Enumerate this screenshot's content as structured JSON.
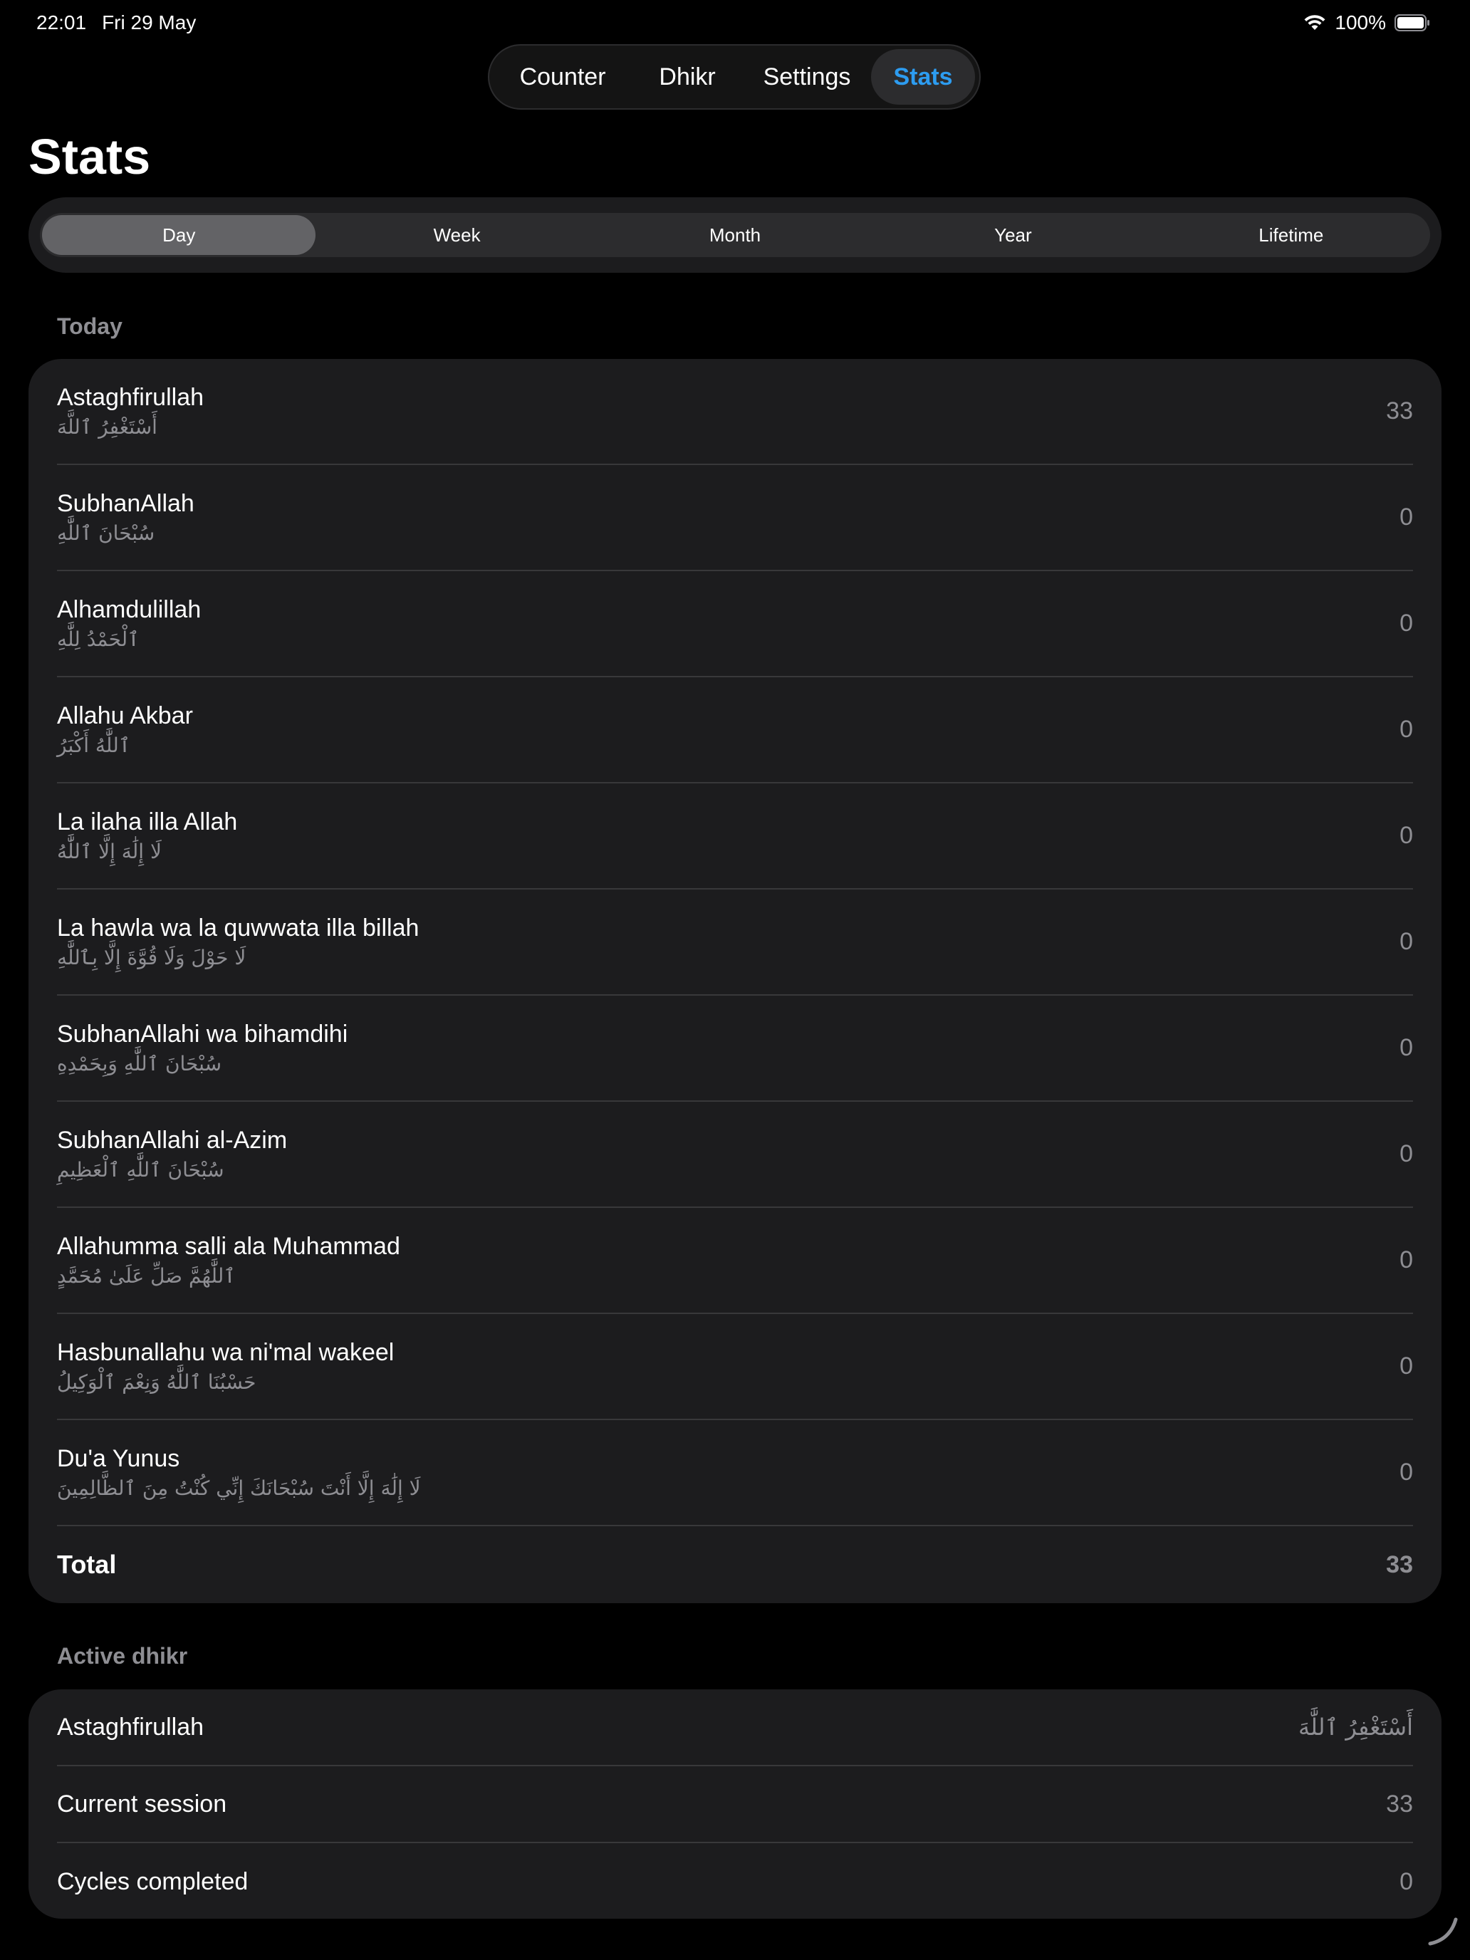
{
  "status_bar": {
    "time": "22:01",
    "date": "Fri 29 May",
    "battery": "100%"
  },
  "top_tabs": [
    {
      "label": "Counter",
      "active": false
    },
    {
      "label": "Dhikr",
      "active": false
    },
    {
      "label": "Settings",
      "active": false
    },
    {
      "label": "Stats",
      "active": true
    }
  ],
  "page_title": "Stats",
  "periods": [
    {
      "label": "Day",
      "active": true
    },
    {
      "label": "Week",
      "active": false
    },
    {
      "label": "Month",
      "active": false
    },
    {
      "label": "Year",
      "active": false
    },
    {
      "label": "Lifetime",
      "active": false
    }
  ],
  "today": {
    "header": "Today",
    "items": [
      {
        "name": "Astaghfirullah",
        "arabic": "أَسْتَغْفِرُ ٱللَّهَ",
        "count": "33"
      },
      {
        "name": "SubhanAllah",
        "arabic": "سُبْحَانَ ٱللَّٰهِ",
        "count": "0"
      },
      {
        "name": "Alhamdulillah",
        "arabic": "ٱلْحَمْدُ لِلَّٰهِ",
        "count": "0"
      },
      {
        "name": "Allahu Akbar",
        "arabic": "ٱللَّٰهُ أَكْبَرُ",
        "count": "0"
      },
      {
        "name": "La ilaha illa Allah",
        "arabic": "لَا إِلَٰهَ إِلَّا ٱللَّٰهُ",
        "count": "0"
      },
      {
        "name": "La hawla wa la quwwata illa billah",
        "arabic": "لَا حَوْلَ وَلَا قُوَّةَ إِلَّا بِٱللَّٰهِ",
        "count": "0"
      },
      {
        "name": "SubhanAllahi wa bihamdihi",
        "arabic": "سُبْحَانَ ٱللَّٰهِ وَبِحَمْدِهِ",
        "count": "0"
      },
      {
        "name": "SubhanAllahi al-Azim",
        "arabic": "سُبْحَانَ ٱللَّٰهِ ٱلْعَظِيمِ",
        "count": "0"
      },
      {
        "name": "Allahumma salli ala Muhammad",
        "arabic": "ٱللَّٰهُمَّ صَلِّ عَلَىٰ مُحَمَّدٍ",
        "count": "0"
      },
      {
        "name": "Hasbunallahu wa ni'mal wakeel",
        "arabic": "حَسْبُنَا ٱللَّٰهُ وَنِعْمَ ٱلْوَكِيلُ",
        "count": "0"
      },
      {
        "name": "Du'a Yunus",
        "arabic": "لَا إِلَٰهَ إِلَّا أَنْتَ سُبْحَانَكَ إِنِّي كُنْتُ مِنَ ٱلظَّالِمِينَ",
        "count": "0"
      }
    ],
    "total_label": "Total",
    "total_value": "33"
  },
  "active": {
    "header": "Active dhikr",
    "name": "Astaghfirullah",
    "arabic": "أَسْتَغْفِرُ ٱللَّٰهَ",
    "session_label": "Current session",
    "session_value": "33",
    "cycles_label": "Cycles completed",
    "cycles_value": "0"
  },
  "colors": {
    "background": "#000000",
    "card": "#1c1c1e",
    "accent": "#2d9cf0",
    "secondary_text": "#8e8e93",
    "separator": "#38383a"
  }
}
